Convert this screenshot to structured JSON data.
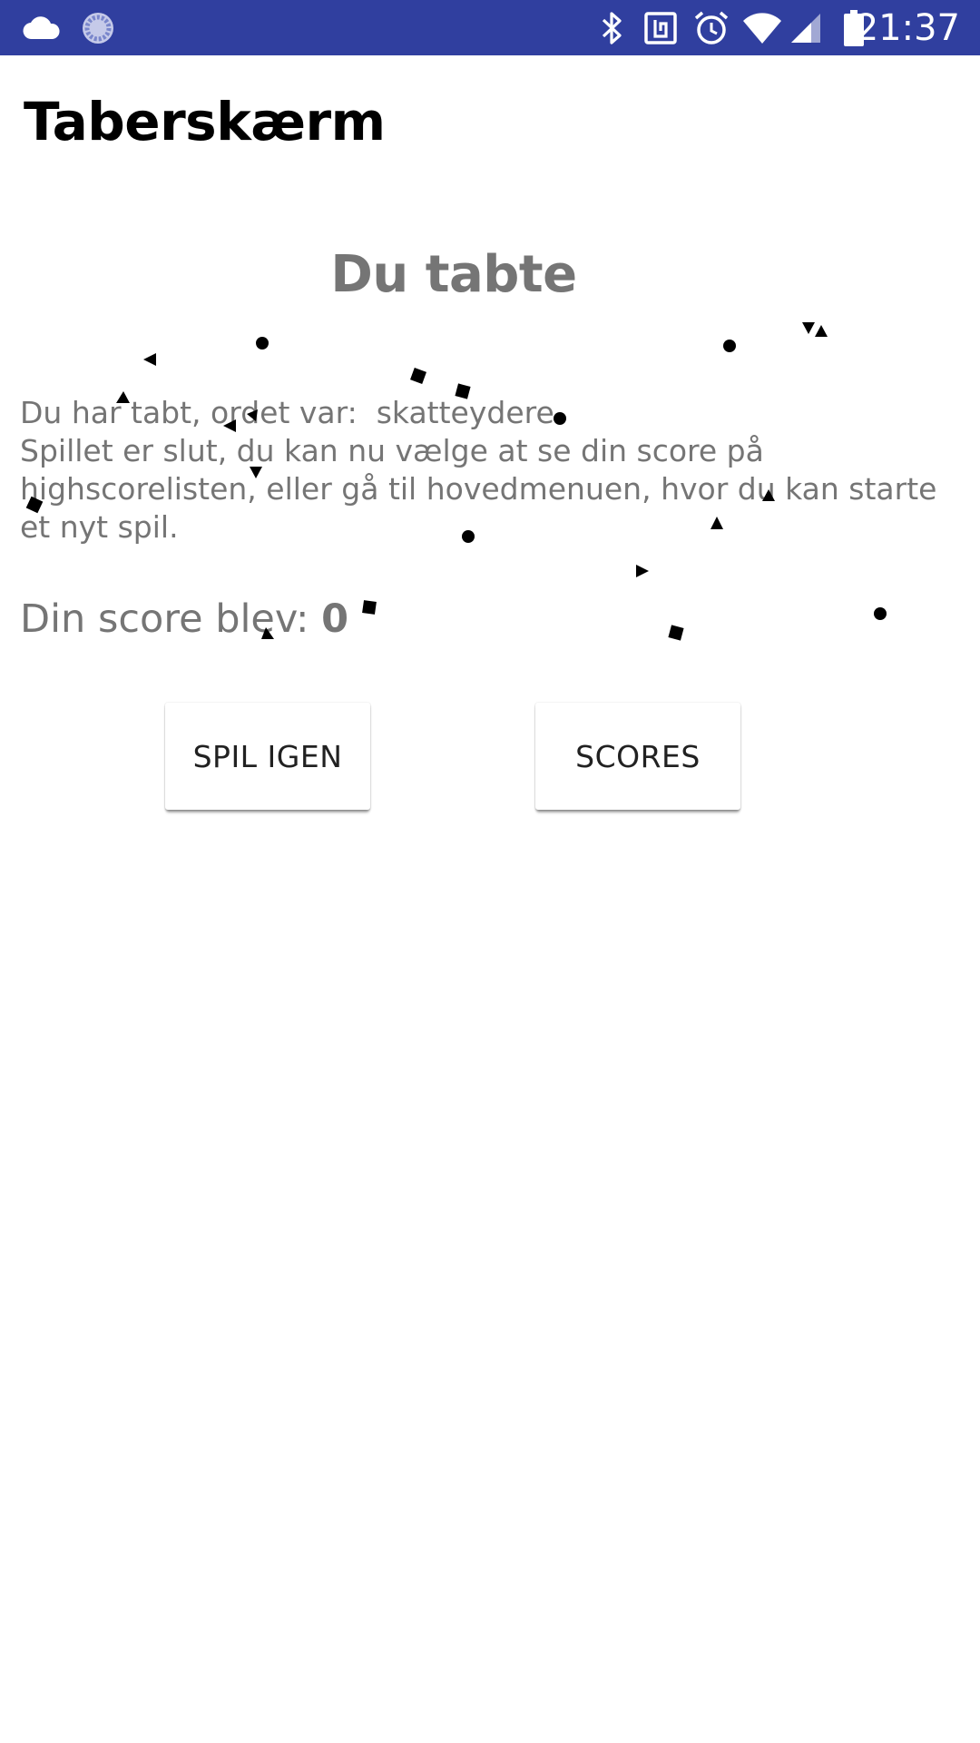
{
  "status_bar": {
    "time": "21:37",
    "bar_color": "#303F9F",
    "left_icons": [
      "cloud-icon",
      "sync-icon"
    ],
    "right_icons": [
      "bluetooth-icon",
      "nfc-icon",
      "alarm-icon",
      "wifi-icon",
      "signal-icon",
      "battery-icon"
    ]
  },
  "app_bar": {
    "title": "Taberskærm"
  },
  "main": {
    "headline": "Du tabte",
    "message_lines": [
      "Du har tabt, ordet var:  skatteydere",
      "Spillet er slut, du kan nu vælge at se din score på",
      "highscorelisten, eller gå til hovedmenuen, hvor du kan starte",
      "et nyt spil."
    ],
    "score_label": "Din score blev: ",
    "score_value": "0"
  },
  "buttons": {
    "play_again": "SPIL IGEN",
    "scores": "SCORES"
  },
  "colors": {
    "primary_dark": "#303F9F",
    "text_secondary": "#757575",
    "confetti": "#000000"
  }
}
